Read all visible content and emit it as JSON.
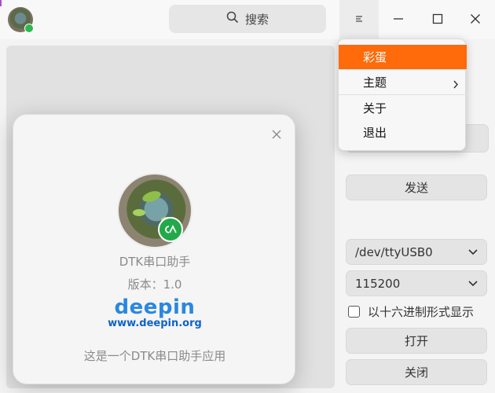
{
  "titlebar": {
    "search_placeholder": "搜索",
    "icons": {
      "search": "search-icon",
      "menu": "hamburger-menu-icon",
      "minimize": "minimize-icon",
      "maximize": "maximize-icon",
      "close": "close-icon"
    }
  },
  "menu": {
    "items": [
      {
        "label": "彩蛋",
        "active": true
      },
      {
        "label": "主题",
        "has_submenu": true
      },
      {
        "label": "关于"
      },
      {
        "label": "退出"
      }
    ],
    "accent": "#ff6a0a"
  },
  "sidebar": {
    "send_label": "发送",
    "port_value": "/dev/ttyUSB0",
    "baud_value": "115200",
    "hex_checkbox_label": "以十六进制形式显示",
    "hex_checked": false,
    "open_label": "打开",
    "close_label": "关闭"
  },
  "about": {
    "app_name": "DTK串口助手",
    "version": "版本：1.0",
    "company_logo_text": "deepin",
    "website": "www.deepin.org",
    "description": "这是一个DTK串口助手应用"
  }
}
